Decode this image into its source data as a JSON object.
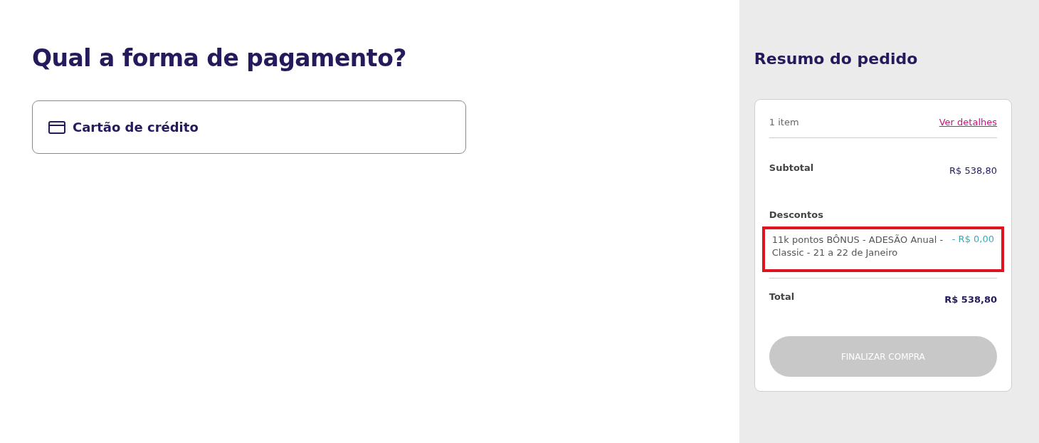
{
  "payment": {
    "title": "Qual a forma de pagamento?",
    "options": [
      {
        "label": "Cartão de crédito",
        "kind": "card"
      }
    ]
  },
  "summary": {
    "title": "Resumo do pedido",
    "item_count": "1 item",
    "details_link": "Ver detalhes",
    "subtotal": {
      "label": "Subtotal",
      "value": "R$ 538,80"
    },
    "discounts": {
      "label": "Descontos",
      "items": [
        {
          "name": "11k pontos BÔNUS - ADESÃO Anual - Classic - 21 a 22 de Janeiro",
          "value": "- R$ 0,00",
          "highlighted": true
        }
      ]
    },
    "total": {
      "label": "Total",
      "value": "R$ 538,80"
    },
    "checkout": {
      "label": "FINALIZAR COMPRA",
      "disabled": true
    }
  }
}
